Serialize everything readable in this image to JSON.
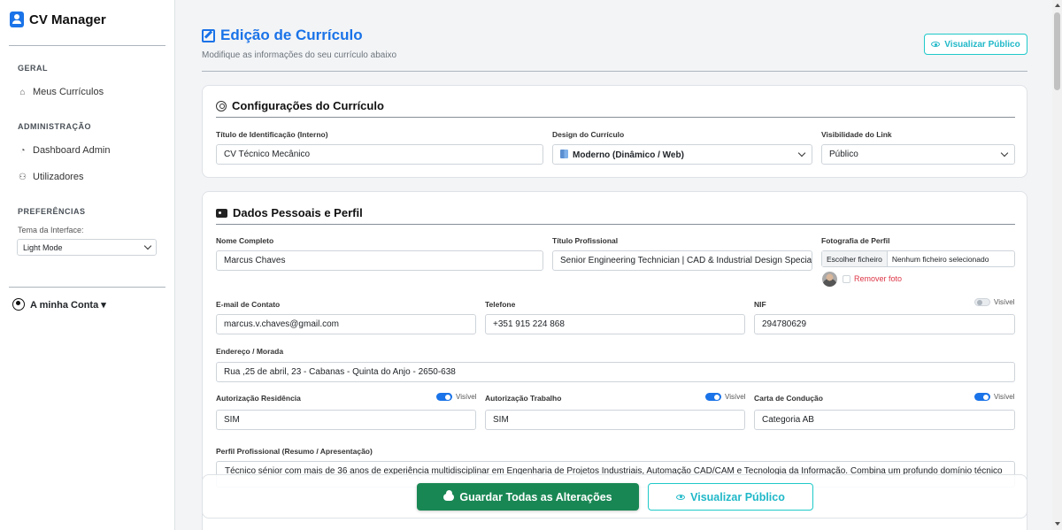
{
  "app": {
    "title": "CV Manager"
  },
  "sidebar": {
    "sections": {
      "geral": "GERAL",
      "admin": "ADMINISTRAÇÃO",
      "prefs": "PREFERÊNCIAS"
    },
    "items": {
      "meus_curriculos": "Meus Currículos",
      "dashboard_admin": "Dashboard Admin",
      "utilizadores": "Utilizadores"
    },
    "theme_label": "Tema da Interface:",
    "theme_value": "Light Mode",
    "account_label": "A minha Conta ▾"
  },
  "header": {
    "title": "Edição de Currículo",
    "subtitle": "Modifique as informações do seu currículo abaixo",
    "view_public": "Visualizar Público"
  },
  "config": {
    "title": "Configurações do Currículo",
    "fields": {
      "titulo_label": "Título de Identificação (Interno)",
      "titulo_value": "CV Técnico Mecânico",
      "design_label": "Design do Currículo",
      "design_value": "Moderno (Dinâmico / Web)",
      "visibilidade_label": "Visibilidade do Link",
      "visibilidade_value": "Público"
    }
  },
  "personal": {
    "title": "Dados Pessoais e Perfil",
    "nome_label": "Nome Completo",
    "nome_value": "Marcus Chaves",
    "titulo_prof_label": "Título Profissional",
    "titulo_prof_value": "Senior Engineering Technician  |  CAD & Industrial Design  Specialist",
    "foto_label": "Fotografia de Perfil",
    "file_button": "Escolher ficheiro",
    "file_name": "Nenhum ficheiro selecionado",
    "remove_photo": "Remover foto",
    "email_label": "E-mail de Contato",
    "email_value": "marcus.v.chaves@gmail.com",
    "telefone_label": "Telefone",
    "telefone_value": "+351 915 224 868",
    "nif_label": "NIF",
    "nif_value": "294780629",
    "visible_label": "Visível",
    "morada_label": "Endereço / Morada",
    "morada_value": "Rua ,25 de abril, 23 - Cabanas - Quinta do Anjo - 2650-638",
    "residencia_label": "Autorização Residência",
    "residencia_value": "SIM",
    "trabalho_label": "Autorização Trabalho",
    "trabalho_value": "SIM",
    "carta_label": "Carta de Condução",
    "carta_value": "Categoria AB",
    "perfil_label": "Perfil Profissional (Resumo / Apresentação)",
    "perfil_value": "Técnico sénior com mais de 36 anos de experiência multidisciplinar em Engenharia de Projetos Industriais, Automação CAD/CAM e Tecnologia da Informação. Combina um profundo domínio técnico"
  },
  "actions": {
    "save": "Guardar Todas as Alterações",
    "view": "Visualizar Público"
  },
  "colors": {
    "primary": "#1a73e8",
    "success": "#198754",
    "info": "#20c9c9",
    "danger": "#dc3545"
  }
}
